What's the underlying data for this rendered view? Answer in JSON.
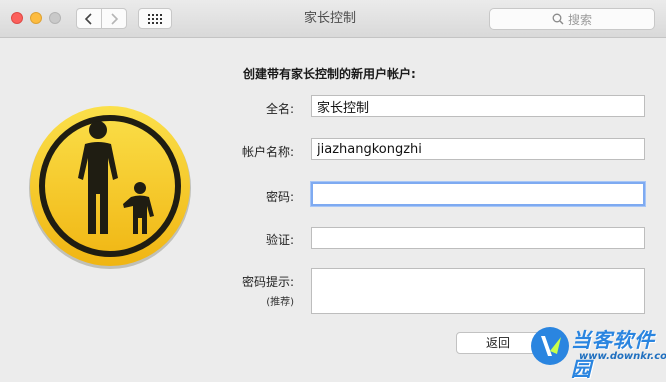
{
  "window": {
    "title": "家长控制",
    "search_placeholder": "搜索"
  },
  "form": {
    "heading": "创建带有家长控制的新用户帐户:",
    "full_name_label": "全名:",
    "full_name_value": "家长控制",
    "account_label": "帐户名称:",
    "account_value": "jiazhangkongzhi",
    "password_label": "密码:",
    "password_value": "",
    "verify_label": "验证:",
    "verify_value": "",
    "hint_label": "密码提示:",
    "hint_sub": "(推荐)",
    "hint_value": ""
  },
  "buttons": {
    "back_label": "返回"
  },
  "watermark": {
    "brand": "当客软件园",
    "url": "www.downkr.com"
  },
  "colors": {
    "icon_yellow": "#f5c518",
    "focus_ring": "#7eaaf1",
    "close": "#fc605c",
    "minimize": "#fdbc40"
  }
}
